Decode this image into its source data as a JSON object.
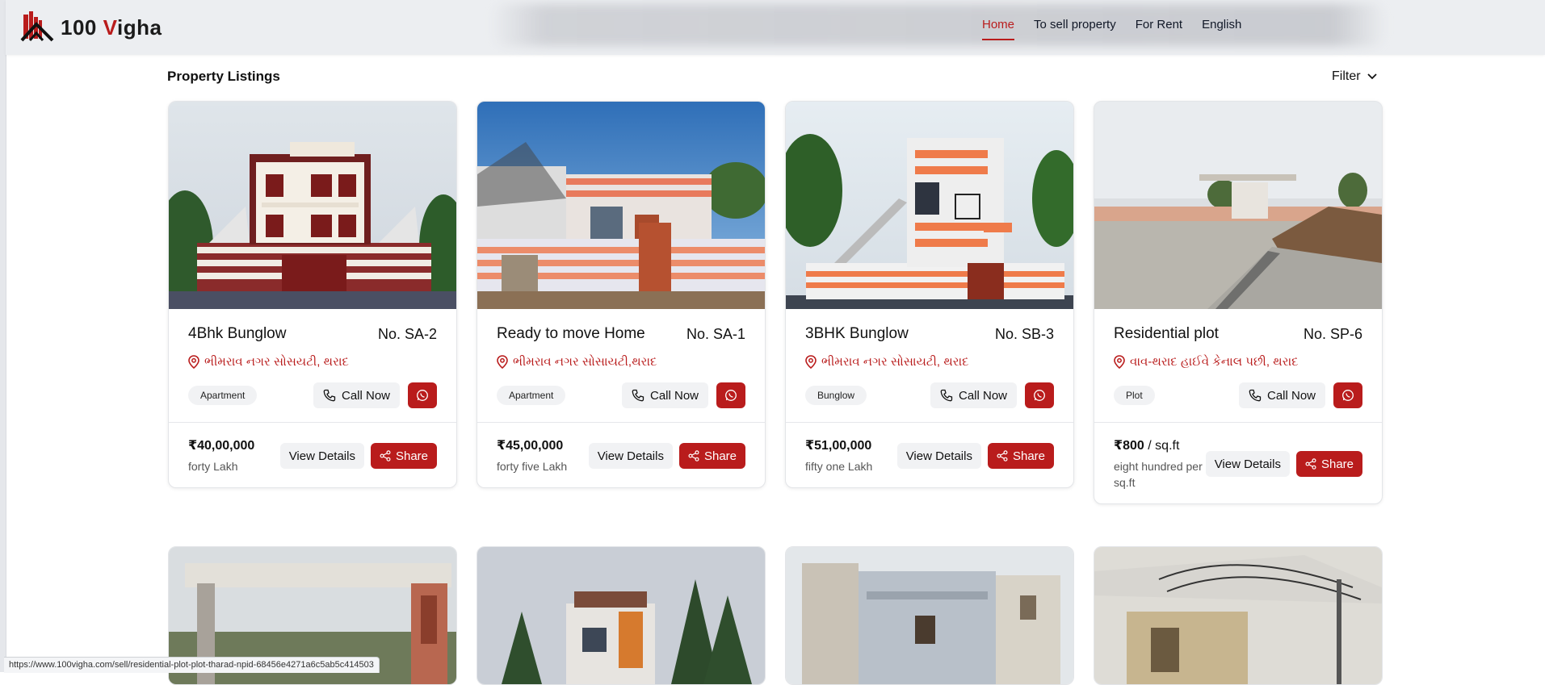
{
  "brand": {
    "number": "100",
    "v": "V",
    "rest": "igha"
  },
  "nav": {
    "home": "Home",
    "sell": "To sell property",
    "rent": "For Rent",
    "language": "English"
  },
  "page": {
    "title": "Property Listings",
    "filter_label": "Filter"
  },
  "buttons": {
    "call": "Call Now",
    "view": "View Details",
    "share": "Share"
  },
  "listings": [
    {
      "title": "4Bhk Bunglow",
      "number": "No. SA-2",
      "location": "ભીમરાવ નગર સોસયટી, થરાદ",
      "type": "Apartment",
      "price": "₹40,00,000",
      "price_unit": "",
      "price_words": "forty Lakh"
    },
    {
      "title": "Ready to move Home",
      "number": "No. SA-1",
      "location": "ભીમરાવ નગર સોસાયટી,થરાદ",
      "type": "Apartment",
      "price": "₹45,00,000",
      "price_unit": "",
      "price_words": "forty five Lakh"
    },
    {
      "title": "3BHK Bunglow",
      "number": "No. SB-3",
      "location": "ભીમરાવ નગર સોસાયટી, થરાદ",
      "type": "Bunglow",
      "price": "₹51,00,000",
      "price_unit": "",
      "price_words": "fifty one Lakh"
    },
    {
      "title": "Residential plot",
      "number": "No. SP-6",
      "location": "વાવ-થરાદ હાઈવે કેનાલ પછી, થરાદ",
      "type": "Plot",
      "price": "₹800",
      "price_unit": " / sq.ft",
      "price_words": "eight hundred per sq.ft"
    }
  ],
  "status_url": "https://www.100vigha.com/sell/residential-plot-plot-tharad-npid-68456e4271a6c5ab5c414503",
  "colors": {
    "accent": "#b91c1c",
    "nav_bg": "#eceef1"
  }
}
